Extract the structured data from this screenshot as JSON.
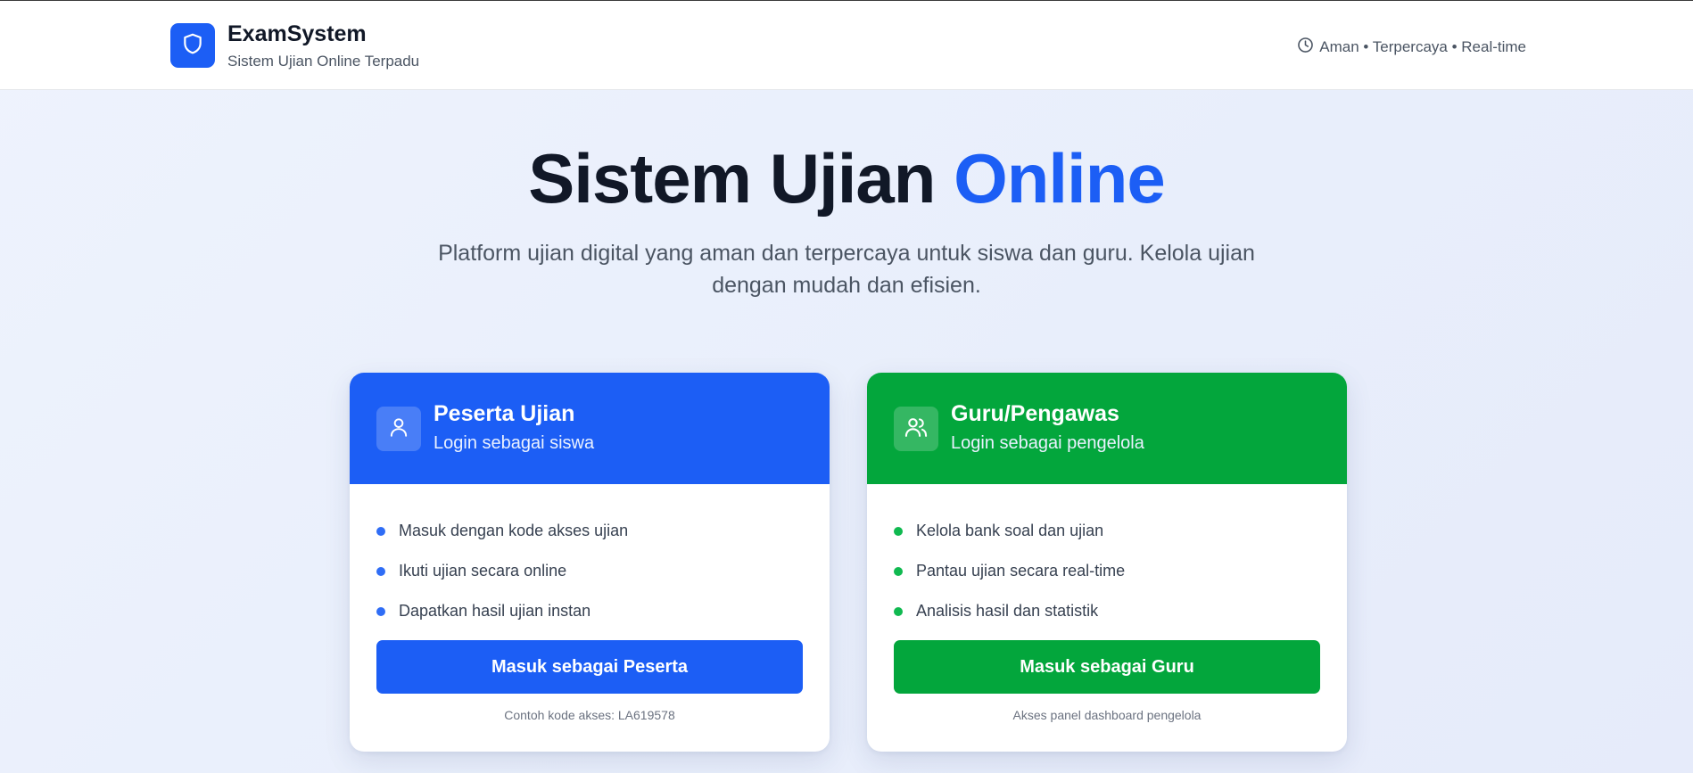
{
  "header": {
    "brand_title": "ExamSystem",
    "brand_subtitle": "Sistem Ujian Online Terpadu",
    "tagline": "Aman • Terpercaya • Real-time",
    "logo_icon": "shield-icon",
    "tagline_icon": "clock-icon"
  },
  "hero": {
    "title_main": "Sistem Ujian ",
    "title_accent": "Online",
    "subtitle": "Platform ujian digital yang aman dan terpercaya untuk siswa dan guru. Kelola ujian dengan mudah dan efisien."
  },
  "cards": {
    "student": {
      "icon": "user-icon",
      "title": "Peserta Ujian",
      "subtitle": "Login sebagai siswa",
      "features": [
        "Masuk dengan kode akses ujian",
        "Ikuti ujian secara online",
        "Dapatkan hasil ujian instan"
      ],
      "button_label": "Masuk sebagai Peserta",
      "note": "Contoh kode akses: LA619578",
      "color": "#1c5ef5"
    },
    "teacher": {
      "icon": "users-icon",
      "title": "Guru/Pengawas",
      "subtitle": "Login sebagai pengelola",
      "features": [
        "Kelola bank soal dan ujian",
        "Pantau ujian secara real-time",
        "Analisis hasil dan statistik"
      ],
      "button_label": "Masuk sebagai Guru",
      "note": "Akses panel dashboard pengelola",
      "color": "#03a63c"
    }
  }
}
